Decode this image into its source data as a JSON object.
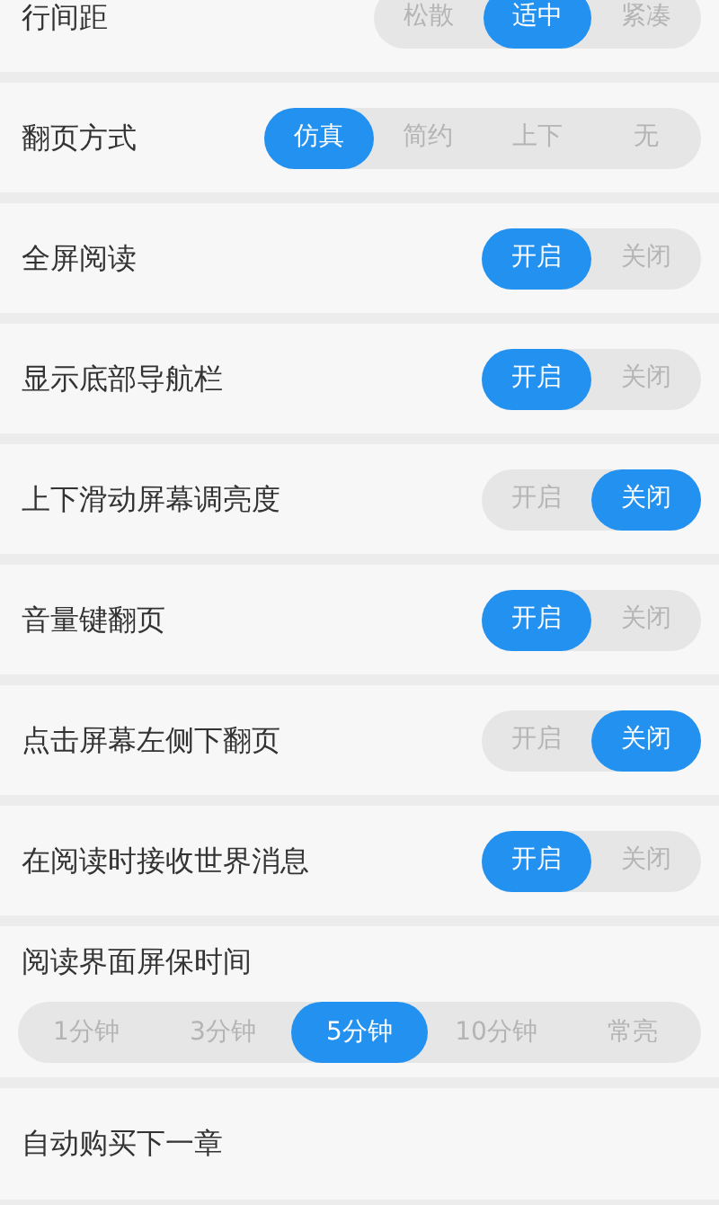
{
  "settings": [
    {
      "kind": "inline",
      "label": "行间距",
      "options": [
        {
          "label": "松散",
          "selected": false
        },
        {
          "label": "适中",
          "selected": true
        },
        {
          "label": "紧凑",
          "selected": false
        }
      ]
    },
    {
      "kind": "inline",
      "label": "翻页方式",
      "options": [
        {
          "label": "仿真",
          "selected": true
        },
        {
          "label": "简约",
          "selected": false
        },
        {
          "label": "上下",
          "selected": false
        },
        {
          "label": "无",
          "selected": false
        }
      ]
    },
    {
      "kind": "inline",
      "label": "全屏阅读",
      "options": [
        {
          "label": "开启",
          "selected": true
        },
        {
          "label": "关闭",
          "selected": false
        }
      ]
    },
    {
      "kind": "inline",
      "label": "显示底部导航栏",
      "options": [
        {
          "label": "开启",
          "selected": true
        },
        {
          "label": "关闭",
          "selected": false
        }
      ]
    },
    {
      "kind": "inline",
      "label": "上下滑动屏幕调亮度",
      "options": [
        {
          "label": "开启",
          "selected": false
        },
        {
          "label": "关闭",
          "selected": true
        }
      ]
    },
    {
      "kind": "inline",
      "label": "音量键翻页",
      "options": [
        {
          "label": "开启",
          "selected": true
        },
        {
          "label": "关闭",
          "selected": false
        }
      ]
    },
    {
      "kind": "inline",
      "label": "点击屏幕左侧下翻页",
      "options": [
        {
          "label": "开启",
          "selected": false
        },
        {
          "label": "关闭",
          "selected": true
        }
      ]
    },
    {
      "kind": "inline",
      "label": "在阅读时接收世界消息",
      "options": [
        {
          "label": "开启",
          "selected": true
        },
        {
          "label": "关闭",
          "selected": false
        }
      ]
    },
    {
      "kind": "stacked",
      "label": "阅读界面屏保时间",
      "options": [
        {
          "label": "1分钟",
          "selected": false
        },
        {
          "label": "3分钟",
          "selected": false
        },
        {
          "label": "5分钟",
          "selected": true
        },
        {
          "label": "10分钟",
          "selected": false
        },
        {
          "label": "常亮",
          "selected": false
        }
      ]
    },
    {
      "kind": "plain",
      "label": "自动购买下一章"
    }
  ]
}
